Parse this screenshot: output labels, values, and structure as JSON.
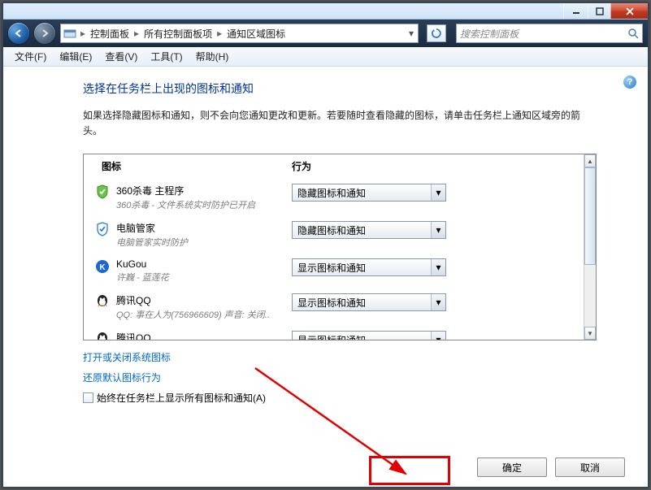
{
  "breadcrumb": {
    "p1": "控制面板",
    "p2": "所有控制面板项",
    "p3": "通知区域图标"
  },
  "search": {
    "placeholder": "搜索控制面板"
  },
  "menu": {
    "file": "文件(F)",
    "edit": "编辑(E)",
    "view": "查看(V)",
    "tools": "工具(T)",
    "help": "帮助(H)"
  },
  "page": {
    "title": "选择在任务栏上出现的图标和通知",
    "desc": "如果选择隐藏图标和通知，则不会向您通知更改和更新。若要随时查看隐藏的图标，请单击任务栏上通知区域旁的箭头。"
  },
  "cols": {
    "icon": "图标",
    "behavior": "行为"
  },
  "options": {
    "hide": "隐藏图标和通知",
    "show": "显示图标和通知"
  },
  "rows": [
    {
      "name": "360杀毒 主程序",
      "sub": "360杀毒 - 文件系统实时防护已开启",
      "sel": "hide",
      "icon": "shield-green"
    },
    {
      "name": "电脑管家",
      "sub": "电脑管家实时防护",
      "sel": "hide",
      "icon": "shield-blue"
    },
    {
      "name": "KuGou",
      "sub": "许巍 - 蓝莲花",
      "sel": "show",
      "icon": "kugou"
    },
    {
      "name": "腾讯QQ",
      "sub": "QQ: 事在人为(756966609) 声音: 关闭..",
      "sel": "show",
      "icon": "qq"
    },
    {
      "name": "腾讯QQ",
      "sub": "",
      "sel": "show",
      "icon": "qq"
    }
  ],
  "links": {
    "systemIcons": "打开或关闭系统图标",
    "restore": "还原默认图标行为"
  },
  "checkbox": {
    "label": "始终在任务栏上显示所有图标和通知(A)"
  },
  "buttons": {
    "ok": "确定",
    "cancel": "取消"
  }
}
